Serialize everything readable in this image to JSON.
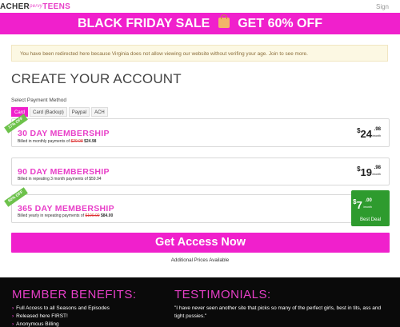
{
  "header": {
    "logo": {
      "part1": "ACHER",
      "part2": "pervy",
      "part3": "TEENS"
    },
    "signin": "Sign"
  },
  "banner": {
    "left": "BLACK FRIDAY SALE",
    "right": "GET 60% OFF"
  },
  "notice": "You have been redirected here because Virginia does not allow viewing our website without verifing your age. Join to see more.",
  "page_title": "CREATE YOUR ACCOUNT",
  "payment": {
    "label": "Select Payment Method",
    "tabs": [
      {
        "label": "Card",
        "active": true
      },
      {
        "label": "Card (Backup)",
        "active": false
      },
      {
        "label": "Paypal",
        "active": false
      },
      {
        "label": "ACH",
        "active": false
      }
    ]
  },
  "plans": [
    {
      "badge": "17% OFF",
      "name": "30 DAY MEMBERSHIP",
      "billed_prefix": "Billed in monthly payments of",
      "old_price": "$29.98",
      "new_price": "$24.98",
      "price_symbol": "$",
      "price_int": "24",
      "price_dec": ".98",
      "price_period": "/month"
    },
    {
      "badge": "",
      "name": "90 DAY MEMBERSHIP",
      "billed_prefix": "Billed in repeating 3 month payments of $59.94",
      "old_price": "",
      "new_price": "",
      "price_symbol": "$",
      "price_int": "19",
      "price_dec": ".98",
      "price_period": "/month"
    },
    {
      "badge": "60% OFF",
      "name": "365 DAY MEMBERSHIP",
      "billed_prefix": "Billed yearly in repeating payments of",
      "old_price": "$199.00",
      "new_price": "$84.00",
      "price_symbol": "$",
      "price_int": "7",
      "price_dec": ".00",
      "price_period": "/month",
      "best_label": "Best Deal"
    }
  ],
  "cta": "Get Access Now",
  "additional_prices": "Additional Prices Available",
  "footer": {
    "benefits_title": "MEMBER BENEFITS:",
    "benefits": [
      "Full Access to all Seasons and Episodes",
      "Released here FIRST!",
      "Anonymous Billing"
    ],
    "testimonials_title": "TESTIMONIALS:",
    "testimonial": "\"I have never seen another site that picks so many of the perfect girls, best in tits, ass and tight pussies.\""
  },
  "colors": {
    "brand_pink": "#f020cc",
    "best_deal_green": "#2e9b2e",
    "badge_green": "#6dc24b",
    "notice_bg": "#fcf8e3"
  }
}
